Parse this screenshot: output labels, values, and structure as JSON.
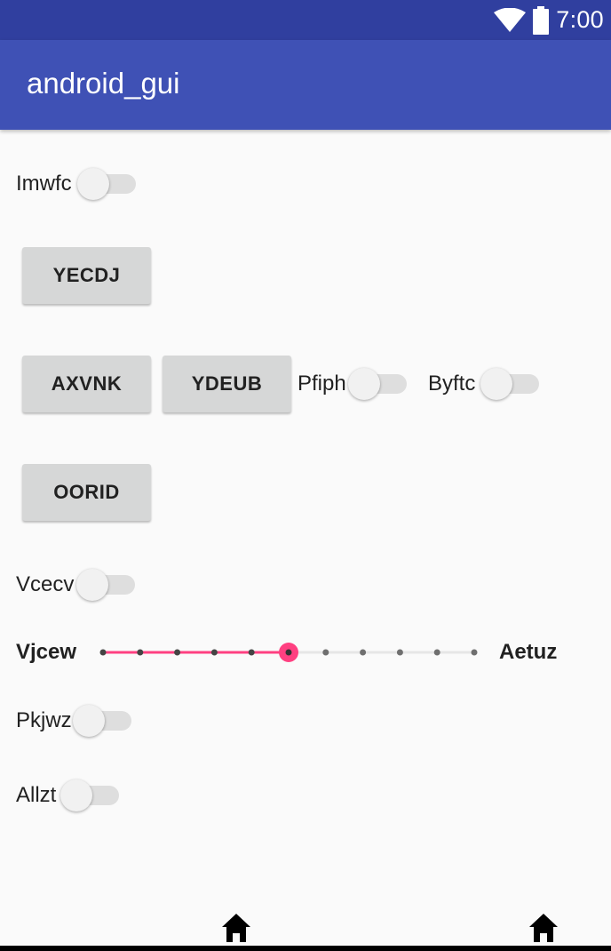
{
  "status_bar": {
    "time": "7:00",
    "icons": [
      "wifi-icon",
      "battery-icon"
    ]
  },
  "app_bar": {
    "title": "android_gui"
  },
  "switches": {
    "imwfc": {
      "label": "Imwfc",
      "checked": false
    },
    "pfiph": {
      "label": "Pfiph",
      "checked": false
    },
    "byftc": {
      "label": "Byftc",
      "checked": false
    },
    "vcecv": {
      "label": "Vcecv",
      "checked": false
    },
    "pkjwz": {
      "label": "Pkjwz",
      "checked": false
    },
    "allzt": {
      "label": "Allzt",
      "checked": false
    }
  },
  "buttons": {
    "yecdj": "YECDJ",
    "axvnk": "AXVNK",
    "ydeub": "YDEUB",
    "oorid": "OORID"
  },
  "seekbar": {
    "left_label": "Vjcew",
    "right_label": "Aetuz",
    "max": 10,
    "value": 5
  },
  "nav_bar": {
    "icons": [
      "home-icon",
      "home-icon"
    ]
  },
  "colors": {
    "status_bar": "#303f9f",
    "app_bar": "#3f51b5",
    "accent": "#ff4081",
    "background": "#fafafa"
  }
}
